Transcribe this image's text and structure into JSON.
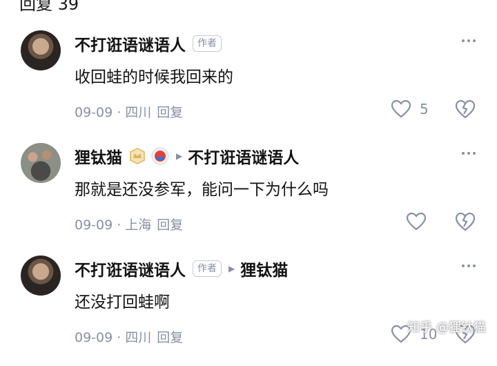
{
  "header": {
    "title": "回复 39"
  },
  "comments": [
    {
      "author": "不打诳语谜语人",
      "author_badge": "作者",
      "reply_to": "",
      "text": "收回蛙的时候我回来的",
      "date": "09-09",
      "location": "四川",
      "reply_label": "回复",
      "likes": "5"
    },
    {
      "author": "狸钛猫",
      "author_badge": "",
      "reply_to": "不打诳语谜语人",
      "text": "那就是还没参军，能问一下为什么吗",
      "date": "09-09",
      "location": "上海",
      "reply_label": "回复",
      "likes": ""
    },
    {
      "author": "不打诳语谜语人",
      "author_badge": "作者",
      "reply_to": "狸钛猫",
      "text": "还没打回蛙啊",
      "date": "09-09",
      "location": "四川",
      "reply_label": "回复",
      "likes": "10"
    }
  ],
  "watermark": "知乎 @狸钛猫",
  "colors": {
    "text": "#121212",
    "meta": "#8590a6",
    "badge_gold": "#e0b35a",
    "medal_red": "#e0413a"
  }
}
